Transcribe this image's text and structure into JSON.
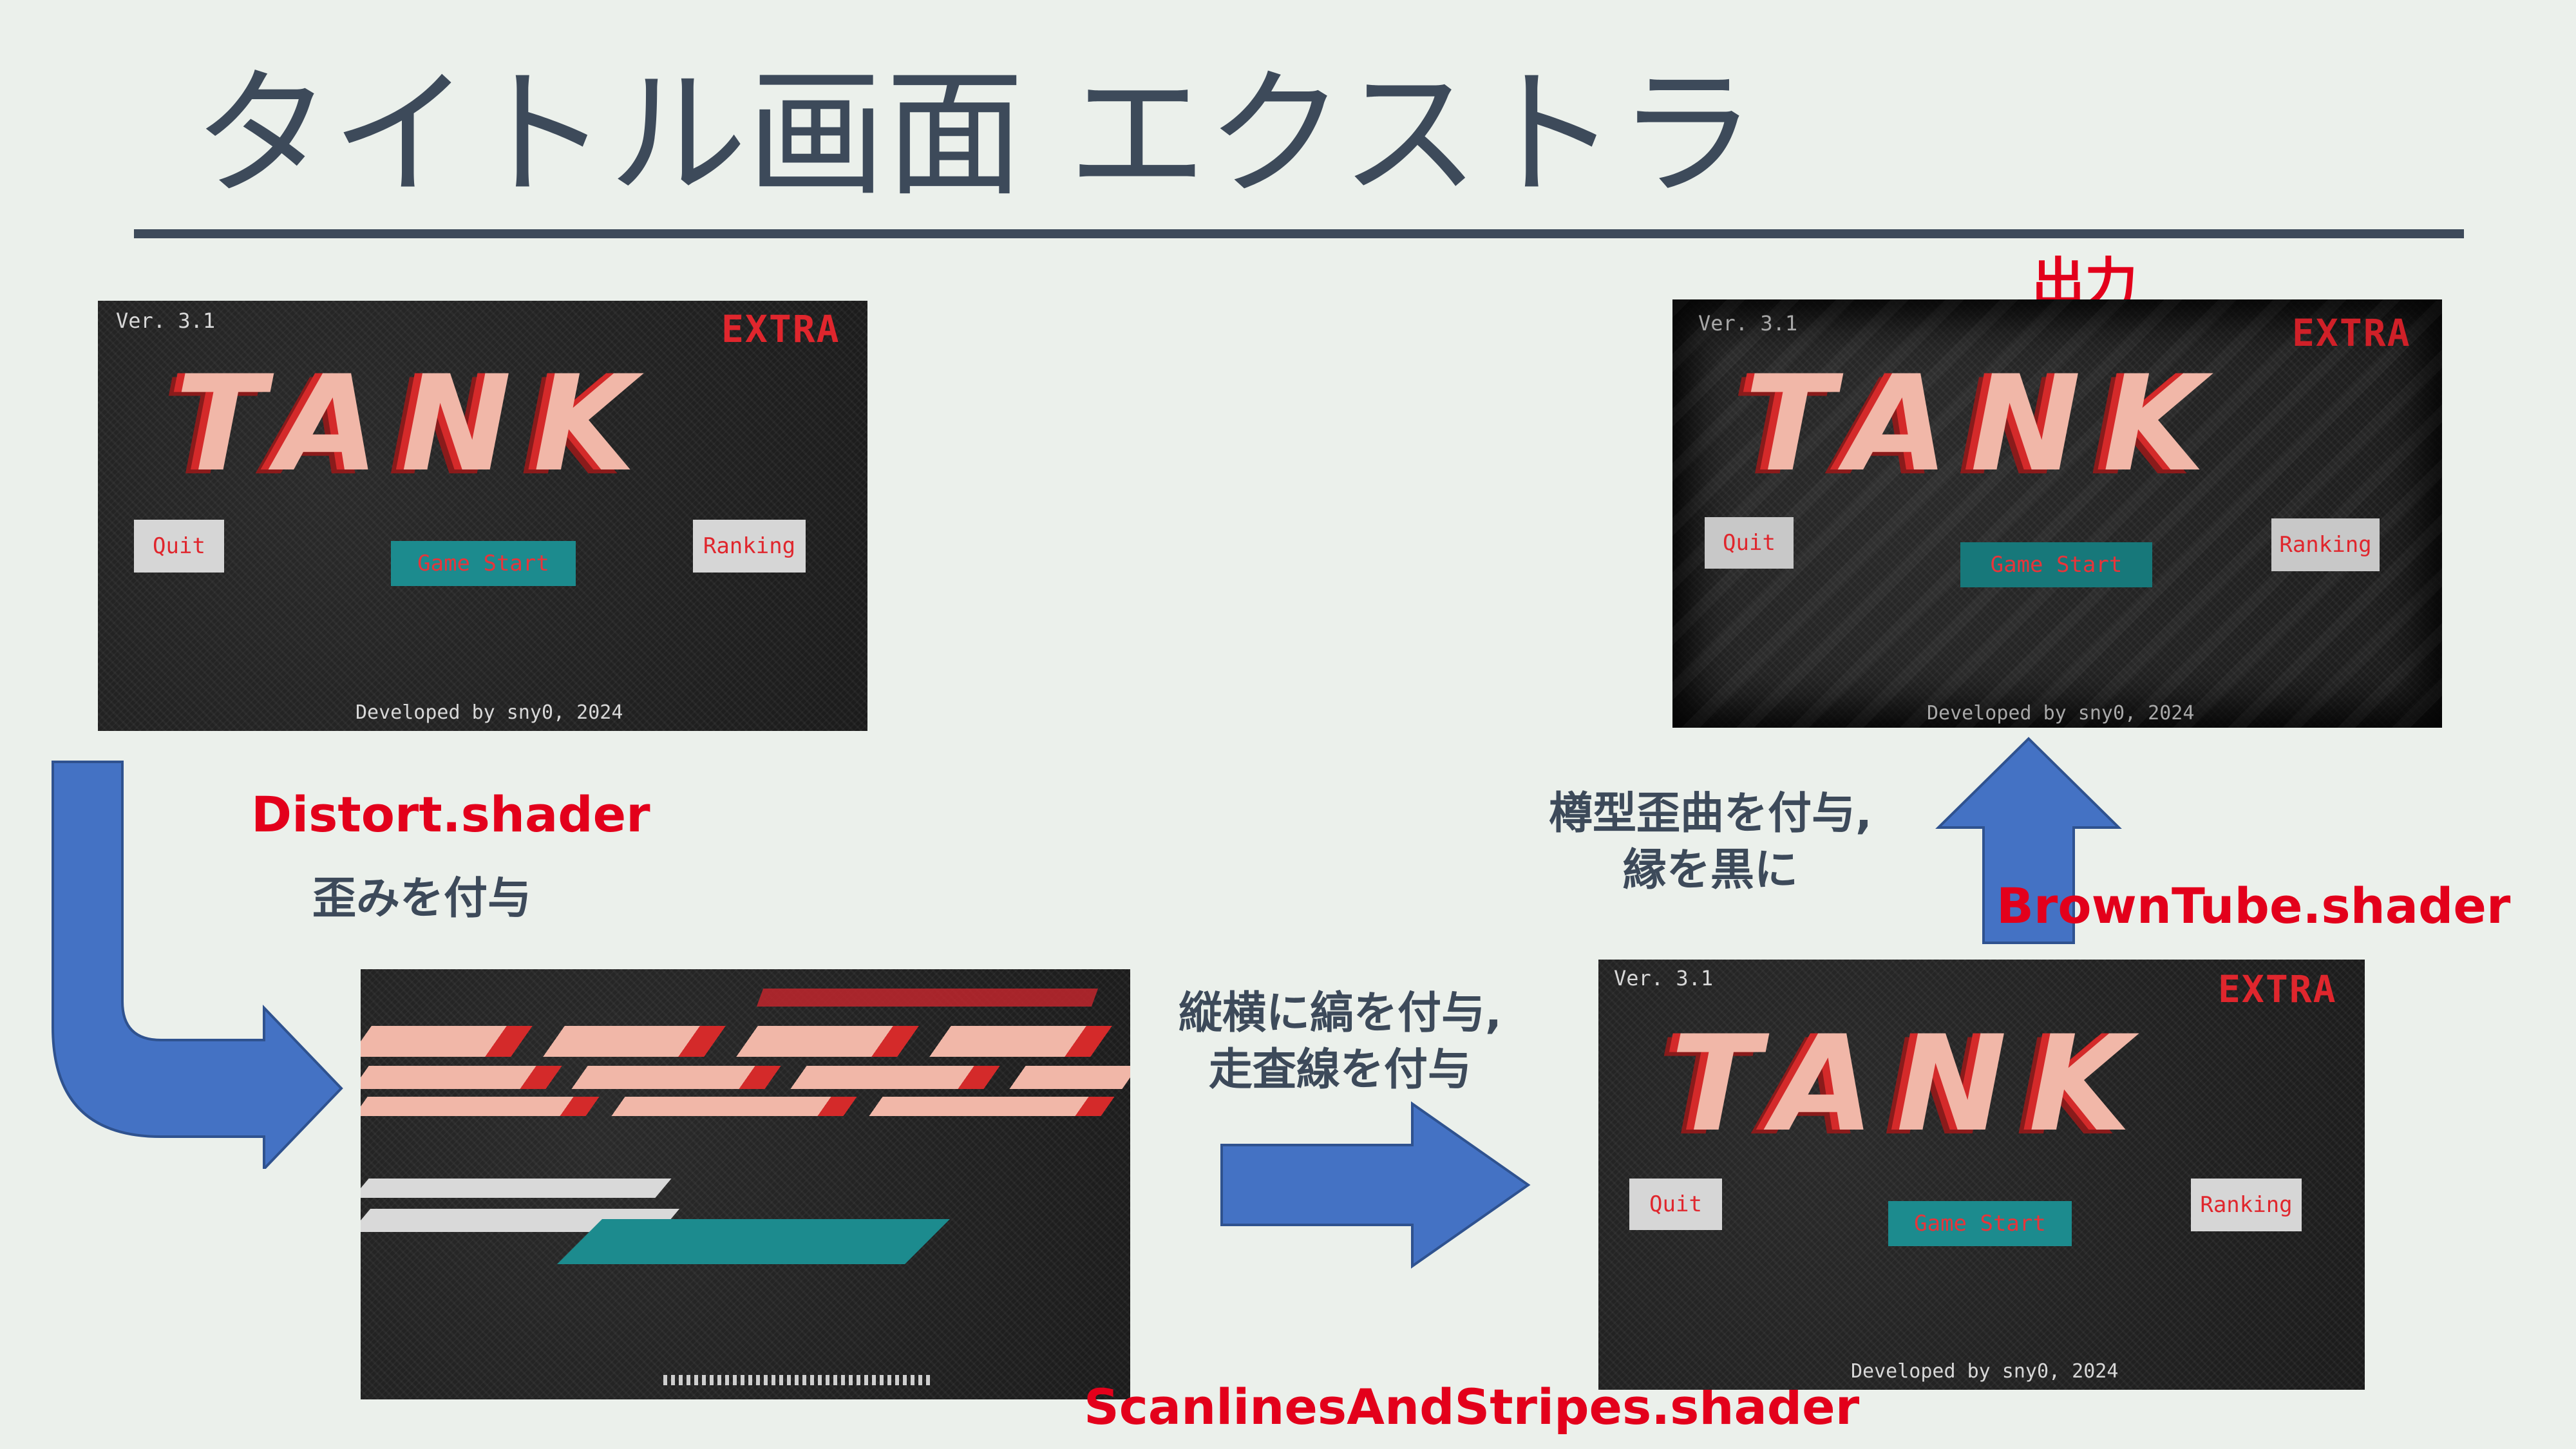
{
  "slide": {
    "title": "タイトル画面 エクストラ"
  },
  "game": {
    "version": "Ver. 3.1",
    "badge": "EXTRA",
    "logo": "TANK",
    "quit": "Quit",
    "ranking": "Ranking",
    "start": "Game Start",
    "developer": "Developed by sny0, 2024"
  },
  "labels": {
    "distort_shader": "Distort.shader",
    "distort_desc": "歪みを付与",
    "scanlines_shader": "ScanlinesAndStripes.shader",
    "scanlines_desc_line1": "縦横に縞を付与,",
    "scanlines_desc_line2": "走査線を付与",
    "browntube_shader": "BrownTube.shader",
    "browntube_desc_line1": "樽型歪曲を付与,",
    "browntube_desc_line2": "縁を黒に",
    "output": "出力"
  },
  "colors": {
    "background": "#ebf0eb",
    "title_text": "#3d4a5a",
    "accent_red": "#e3001b",
    "arrow_blue": "#4472c4",
    "screen_bg": "#1e1e1e",
    "logo_fill": "#f1b7a8",
    "start_button": "#1c8b8e"
  }
}
